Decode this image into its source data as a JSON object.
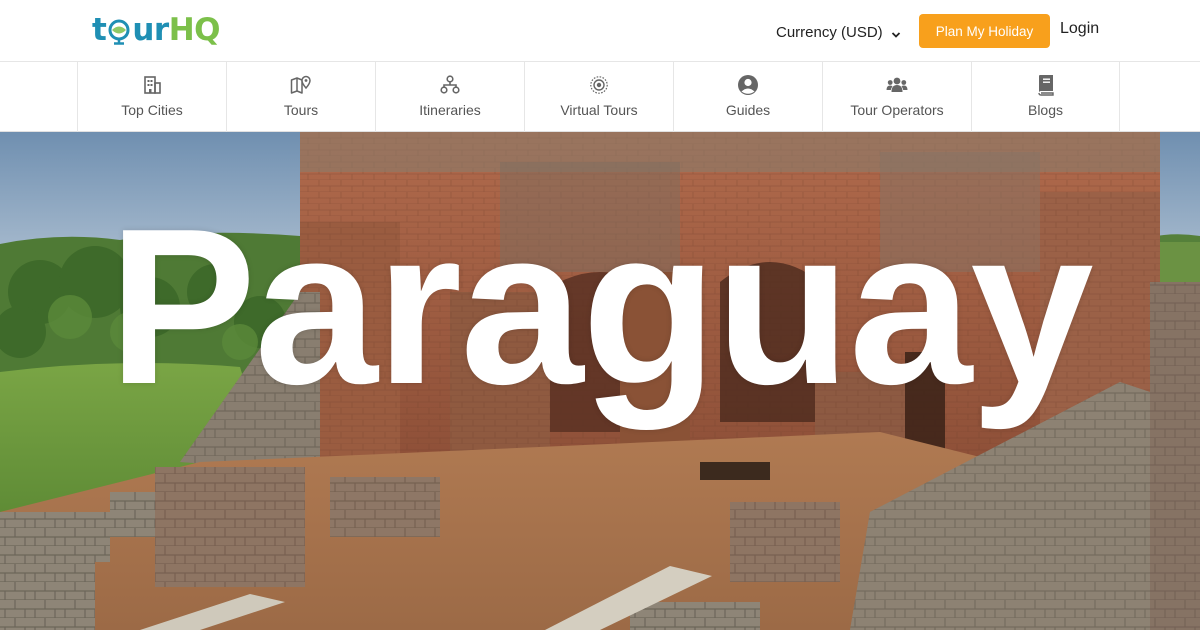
{
  "header": {
    "logo": {
      "part1": "t",
      "part2": "ur",
      "part3": "HQ"
    },
    "currency_label": "Currency (USD)",
    "plan_button": "Plan My Holiday",
    "login_label": "Login"
  },
  "nav": {
    "items": [
      {
        "label": "Top Cities",
        "icon": "building-icon"
      },
      {
        "label": "Tours",
        "icon": "map-pin-icon"
      },
      {
        "label": "Itineraries",
        "icon": "sitemap-icon"
      },
      {
        "label": "Virtual Tours",
        "icon": "virtual-tour-icon"
      },
      {
        "label": "Guides",
        "icon": "user-circle-icon"
      },
      {
        "label": "Tour Operators",
        "icon": "users-icon"
      },
      {
        "label": "Blogs",
        "icon": "book-icon"
      }
    ]
  },
  "hero": {
    "title": "Paraguay"
  },
  "colors": {
    "accent": "#f8a01c",
    "logo_blue": "#1f8fb4",
    "logo_green": "#7cc04a",
    "icon_gray": "#666666"
  }
}
